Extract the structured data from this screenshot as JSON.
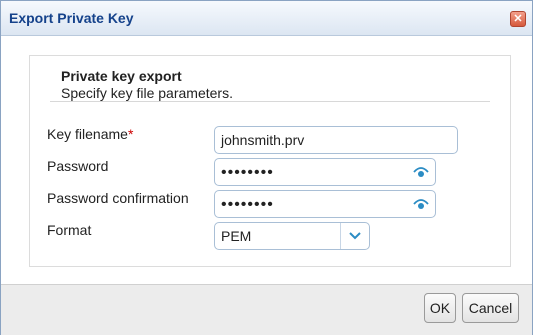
{
  "dialog": {
    "title": "Export Private Key",
    "close_glyph": "✕"
  },
  "section": {
    "title": "Private key export",
    "subtitle": "Specify key file parameters."
  },
  "fields": {
    "filename": {
      "label": "Key filename",
      "required_mark": "*",
      "value": "johnsmith.prv"
    },
    "password": {
      "label": "Password",
      "value": "••••••••",
      "toggle_icon": "eye-icon"
    },
    "password_confirm": {
      "label": "Password confirmation",
      "value": "••••••••",
      "toggle_icon": "eye-icon"
    },
    "format": {
      "label": "Format",
      "value": "PEM",
      "icon": "chevron-down-icon"
    }
  },
  "buttons": {
    "ok": "OK",
    "cancel": "Cancel"
  },
  "colors": {
    "title_text": "#15428b",
    "close_button": "#d65a3c",
    "required": "#cc0000",
    "icon_accent": "#2b8cc4"
  }
}
